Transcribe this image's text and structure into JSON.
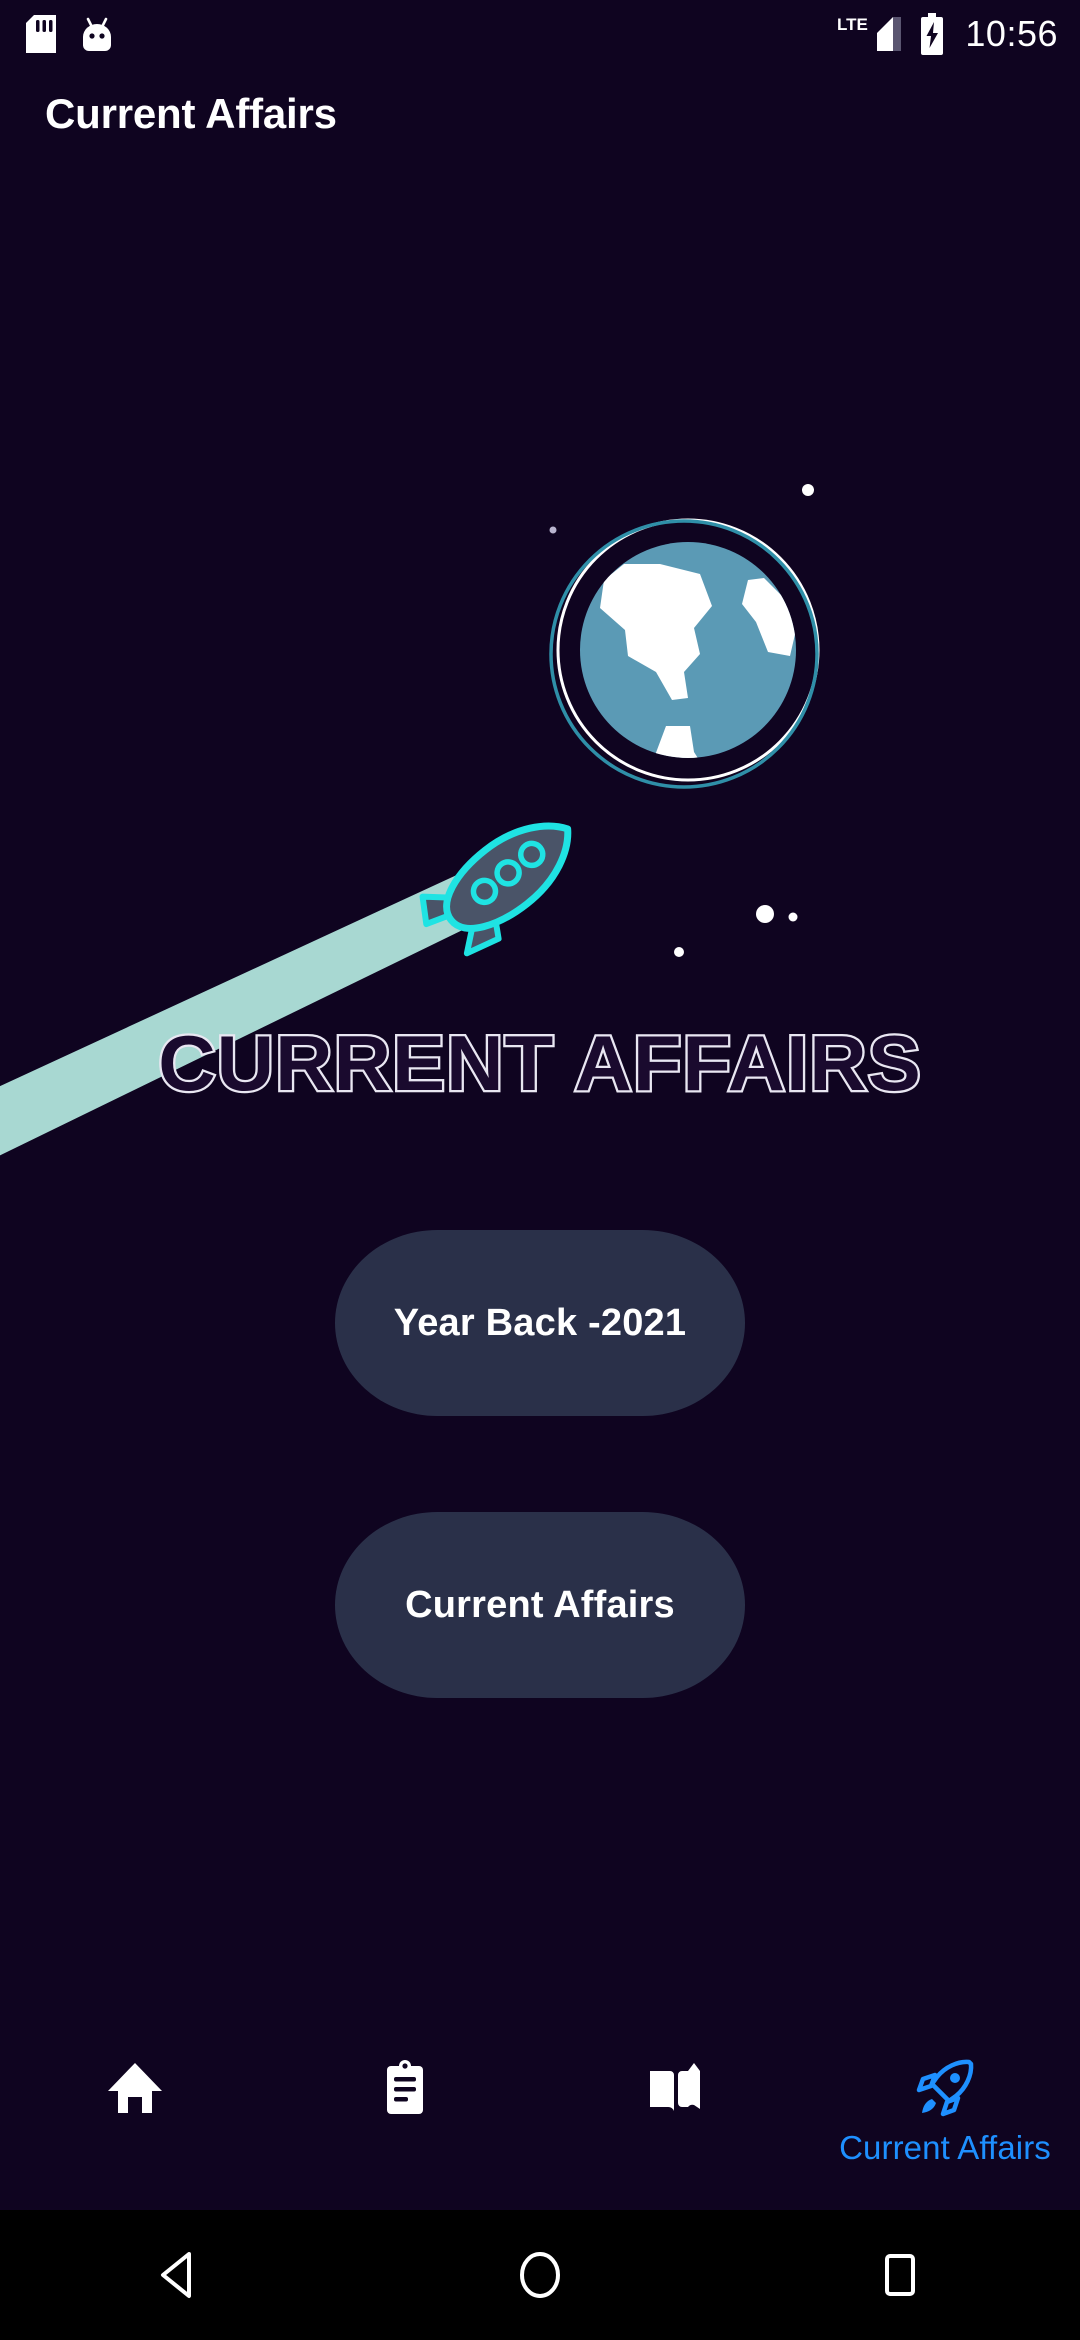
{
  "status_bar": {
    "time": "10:56",
    "network_label": "LTE",
    "icons": [
      "sd-card-icon",
      "android-bugdroid-icon",
      "lte-signal-icon",
      "battery-charging-icon"
    ]
  },
  "app_bar": {
    "title": "Current Affairs"
  },
  "hero": {
    "logo_text": "CURRENT AFFAIRS",
    "illustration": {
      "globe_icon": "earth-globe-icon",
      "rocket_icon": "rocket-icon",
      "trail": "rocket-vapor-trail",
      "stars": "star-dots"
    }
  },
  "buttons": [
    {
      "label": "Year Back -2021",
      "name": "year-back-2021-button"
    },
    {
      "label": "Current Affairs",
      "name": "current-affairs-button"
    }
  ],
  "bottom_nav": {
    "items": [
      {
        "label": "",
        "icon": "home-icon",
        "active": false
      },
      {
        "label": "",
        "icon": "clipboard-icon",
        "active": false
      },
      {
        "label": "",
        "icon": "menu-book-icon",
        "active": false
      },
      {
        "label": "Current Affairs",
        "icon": "rocket-icon",
        "active": true
      }
    ]
  },
  "android_nav": {
    "back": "back-triangle-icon",
    "home": "home-circle-icon",
    "recents": "recents-square-icon"
  },
  "colors": {
    "background": "#0f0420",
    "button_bg": "#2a3049",
    "accent_blue": "#1e90ff",
    "rocket_cyan": "#1fe3e3",
    "rocket_body": "#4a5468",
    "trail": "#a8d8d2",
    "globe_ocean": "#5b9ab5",
    "globe_land": "#ffffff",
    "text_primary": "#ffffff"
  }
}
